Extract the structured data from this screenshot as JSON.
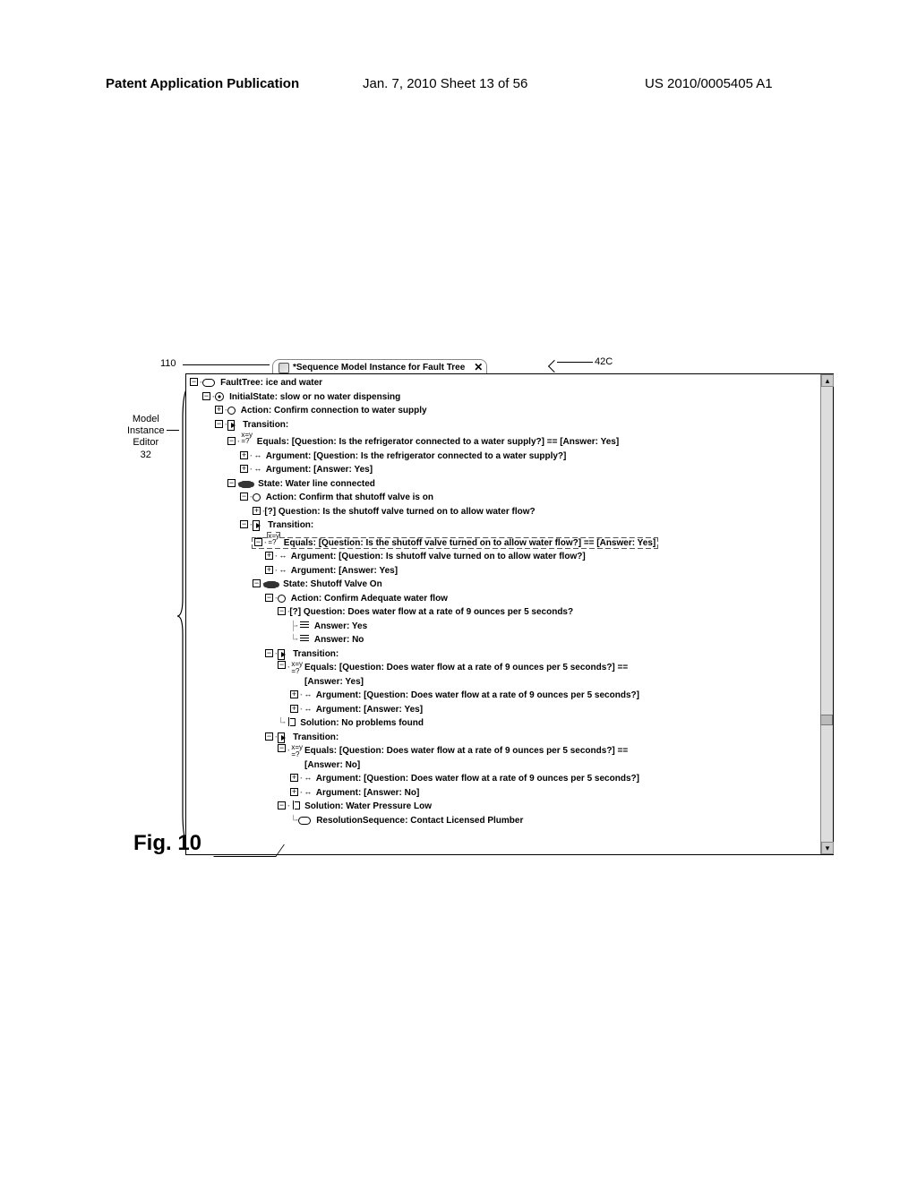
{
  "header": {
    "left": "Patent Application Publication",
    "mid": "Jan. 7, 2010   Sheet 13 of 56",
    "right": "US 2010/0005405 A1"
  },
  "refs": {
    "r110": "110",
    "r42c": "42C",
    "mei_l1": "Model",
    "mei_l2": "Instance",
    "mei_l3": "Editor",
    "mei_l4": "32"
  },
  "tab": {
    "title": "*Sequence Model Instance for Fault Tree",
    "close": "✕"
  },
  "tree": {
    "n0": "FaultTree: ice and water",
    "n1": "InitialState: slow or no water dispensing",
    "n2": "Action: Confirm connection to water supply",
    "n3": "Transition:",
    "n4": "Equals: [Question: Is the refrigerator connected to a water supply?] == [Answer: Yes]",
    "n5": "Argument: [Question: Is the refrigerator connected to a water supply?]",
    "n6": "Argument: [Answer: Yes]",
    "n7": "State: Water line connected",
    "n8": "Action: Confirm that shutoff valve is on",
    "n9": "Question: Is the shutoff valve turned on to allow water flow?",
    "n10": "Transition:",
    "n11": "Equals: [Question: Is the shutoff valve turned on to allow water flow?] == [Answer: Yes]",
    "n12": "Argument: [Question: Is shutoff valve turned on to allow water flow?]",
    "n13": "Argument: [Answer: Yes]",
    "n14": "State: Shutoff Valve On",
    "n15": "Action: Confirm Adequate water flow",
    "n16": "Question: Does water flow at a rate of 9 ounces per 5 seconds?",
    "n17": "Answer: Yes",
    "n18": "Answer: No",
    "n19": "Transition:",
    "n20a": "Equals: [Question: Does water flow at a rate of 9 ounces per 5 seconds?] ==",
    "n20b": "[Answer: Yes]",
    "n21": "Argument: [Question: Does water flow at a rate of 9 ounces per 5 seconds?]",
    "n22": "Argument: [Answer: Yes]",
    "n23": "Solution: No problems found",
    "n24": "Transition:",
    "n25a": "Equals: [Question: Does water flow at a rate of 9 ounces per 5 seconds?] ==",
    "n25b": "[Answer: No]",
    "n26": "Argument: [Question: Does water flow at a rate of 9 ounces per 5 seconds?]",
    "n27": "Argument: [Answer: No]",
    "n28": "Solution: Water Pressure Low",
    "n29": "ResolutionSequence: Contact Licensed Plumber"
  },
  "figure": "Fig. 10"
}
